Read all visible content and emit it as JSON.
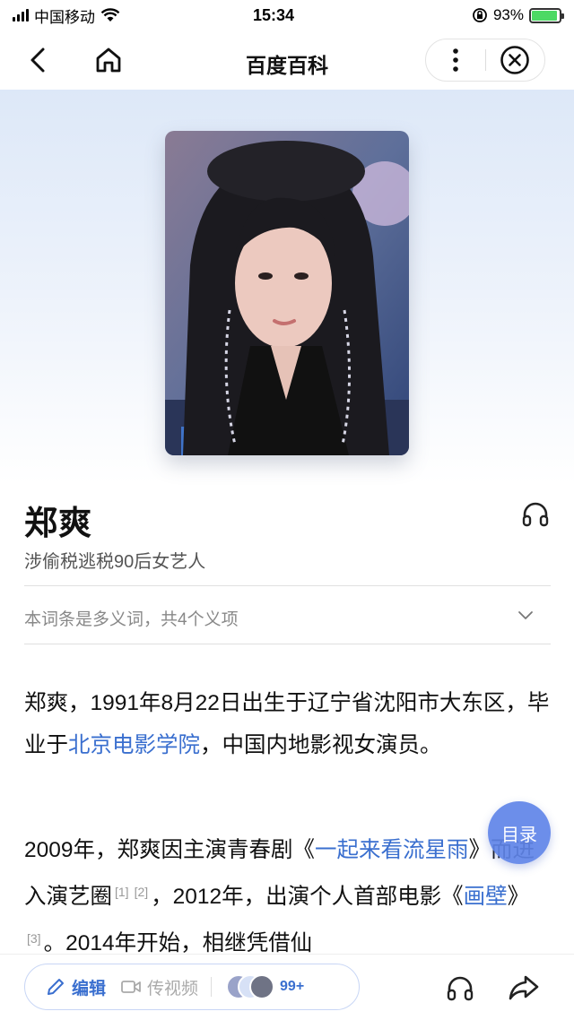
{
  "status_bar": {
    "carrier": "中国移动",
    "time": "15:34",
    "battery_percent": "93%",
    "battery_level": 0.93
  },
  "nav": {
    "title": "百度百科"
  },
  "entry": {
    "title": "郑爽",
    "subtitle": "涉偷税逃税90后女艺人",
    "polysemy_note": "本词条是多义词，共4个义项"
  },
  "content": {
    "p1_a": "郑爽，1991年8月22日出生于辽宁省沈阳市大东区，毕业于",
    "p1_link": "北京电影学院",
    "p1_b": "，中国内地影视女演员。",
    "p2_a": "2009年，郑爽因主演青春剧《",
    "p2_link1": "一起来看流星雨",
    "p2_b": "》而进入演艺圈",
    "p2_ref1": "[1]",
    "p2_ref2": "[2]",
    "p2_c": "，2012年，出演个人首部电影《",
    "p2_link2": "画壁",
    "p2_d": "》",
    "p2_ref3": "[3]",
    "p2_e": "。2014年开始，相继凭借仙"
  },
  "toc_button": "目录",
  "bottom_bar": {
    "edit_label": "编辑",
    "video_label": "传视频",
    "user_count": "99+"
  },
  "colors": {
    "link": "#3a6fcf",
    "toc": "#6084e8",
    "battery": "#4cd964"
  }
}
